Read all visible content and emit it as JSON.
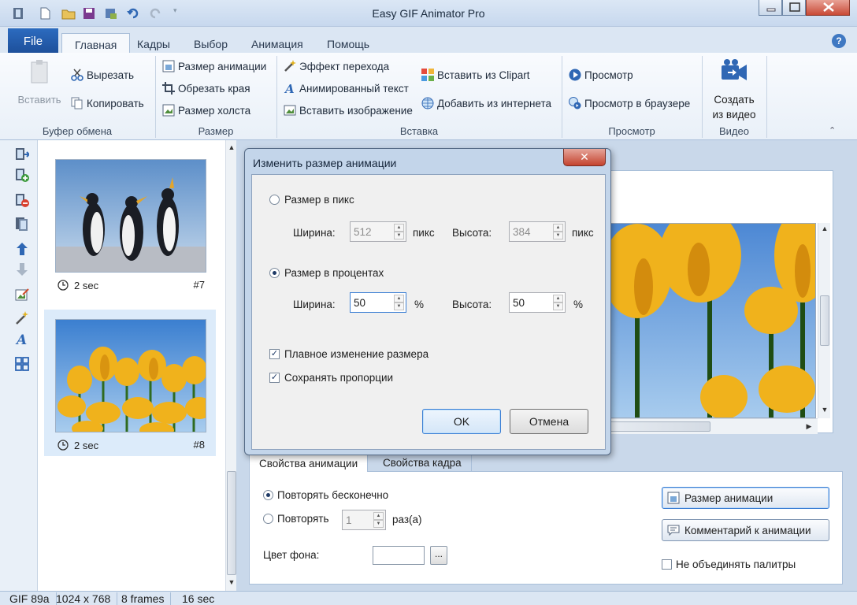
{
  "window": {
    "title": "Easy GIF Animator Pro"
  },
  "ribbon": {
    "file_tab": "File",
    "tabs": [
      "Главная",
      "Кадры",
      "Выбор",
      "Анимация",
      "Помощь"
    ],
    "help": "?",
    "clipboard": {
      "paste": "Вставить",
      "cut": "Вырезать",
      "copy": "Копировать",
      "label": "Буфер обмена"
    },
    "size": {
      "resize_animation": "Размер анимации",
      "crop": "Обрезать края",
      "canvas_size": "Размер холста",
      "label": "Размер"
    },
    "insert": {
      "transition": "Эффект перехода",
      "animated_text": "Анимированный текст",
      "insert_image": "Вставить изображение",
      "clipart": "Вставить из Clipart",
      "internet": "Добавить из интернета",
      "label": "Вставка"
    },
    "preview": {
      "preview": "Просмотр",
      "browser_preview": "Просмотр в браузере",
      "label": "Просмотр"
    },
    "video": {
      "create_line1": "Создать",
      "create_line2": "из видео",
      "label": "Видео"
    }
  },
  "frames": [
    {
      "duration": "2 sec",
      "number": "#7",
      "image": "penguins"
    },
    {
      "duration": "2 sec",
      "number": "#8",
      "image": "tulips",
      "selected": true
    }
  ],
  "dialog": {
    "title": "Изменить размер анимации",
    "close": "✕",
    "pixels_option": "Размер в пикс",
    "width_label": "Ширина:",
    "height_label": "Высота:",
    "px_width": "512",
    "px_height": "384",
    "px_unit": "пикс",
    "percent_option": "Размер в процентах",
    "pct_width": "50",
    "pct_height": "50",
    "pct_unit": "%",
    "smooth_resize": "Плавное изменение размера",
    "keep_proportions": "Сохранять пропорции",
    "ok": "OK",
    "cancel": "Отмена"
  },
  "properties": {
    "tabs": [
      "Свойства анимации",
      "Свойства кадра"
    ],
    "repeat_forever": "Повторять бесконечно",
    "repeat": "Повторять",
    "repeat_count": "1",
    "times": "раз(а)",
    "bg_color": "Цвет фона:",
    "browse": "...",
    "resize_button": "Размер анимации",
    "comment_button": "Комментарий к анимации",
    "no_merge_palettes": "Не объединять палитры"
  },
  "status": {
    "format": "GIF 89a",
    "dimensions": "1024 x 768",
    "frames": "8 frames",
    "duration": "16 sec"
  },
  "colors": {
    "accent": "#2c6bbf",
    "frame_selected": "#dcebfa",
    "window_bg": "#c9d8ea"
  }
}
